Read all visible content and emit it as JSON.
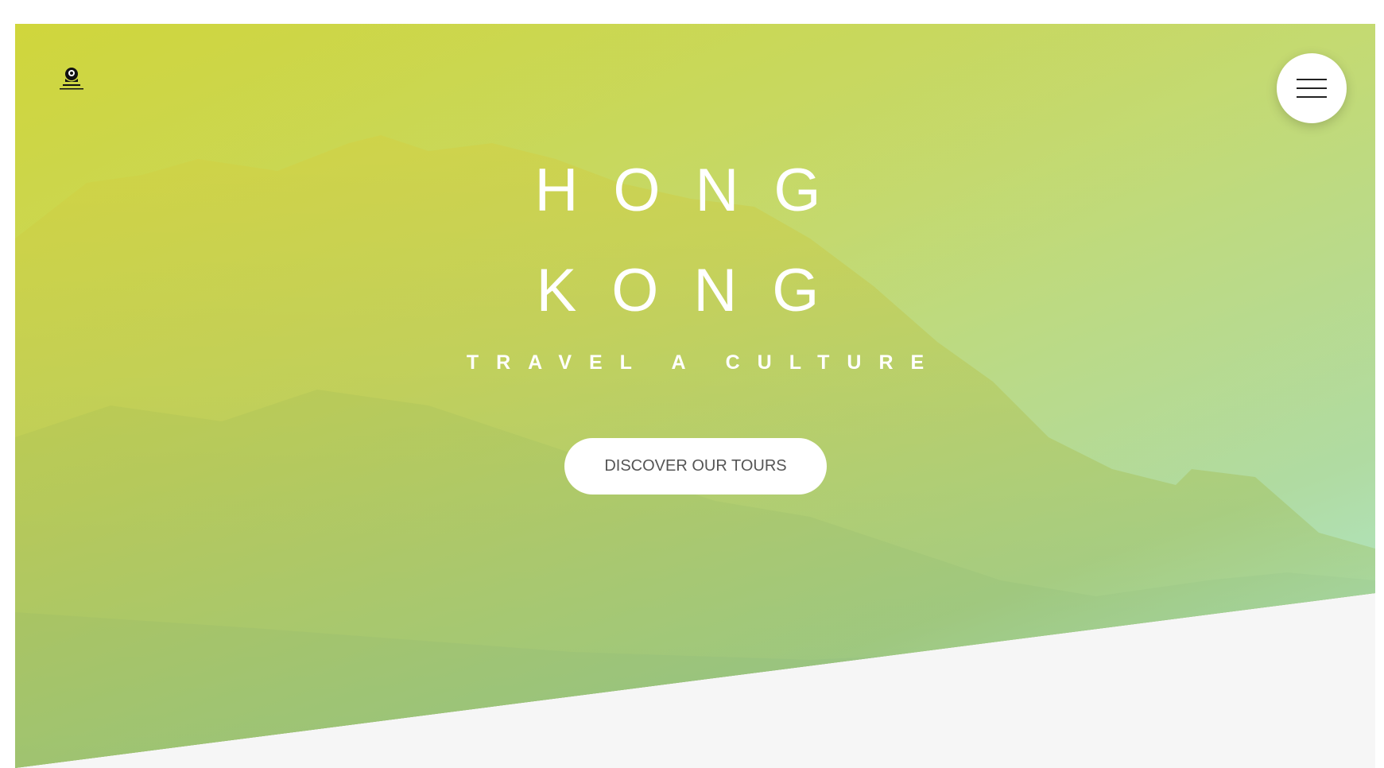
{
  "hero": {
    "title_line1": "HONG",
    "title_line2": "KONG",
    "subtitle": "TRAVEL A CULTURE",
    "cta_label": "DISCOVER OUR TOURS",
    "overlay_colors": [
      "#d2d737",
      "#c4d85f",
      "#a5d796",
      "#aff0dc"
    ]
  },
  "header": {
    "logo_icon": "camera-logo-icon",
    "menu_icon": "hamburger-menu-icon"
  },
  "colors": {
    "button_bg": "#ffffff",
    "button_text": "#555555",
    "title_text": "#ffffff",
    "lower_section_bg": "#f6f6f6"
  }
}
